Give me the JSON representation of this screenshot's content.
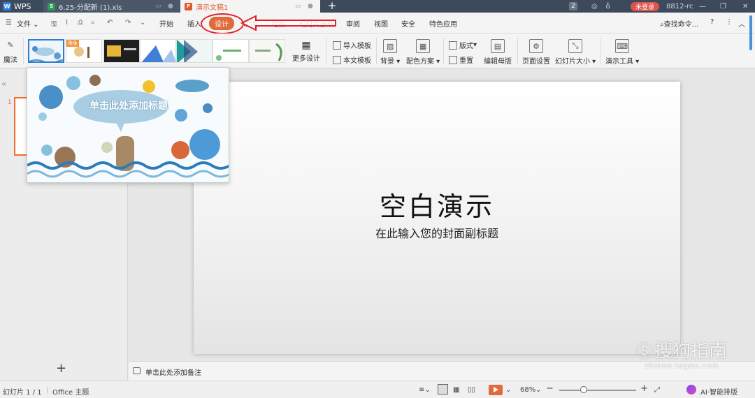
{
  "titlebar": {
    "app_name": "WPS",
    "tabs": [
      {
        "label": "6.25-分配新 (1).xls"
      },
      {
        "label": "演示文稿1"
      }
    ],
    "badge_count": "2",
    "login_label": "未登录",
    "user_id": "8812-rc"
  },
  "menu": {
    "file_label": "文件",
    "items": [
      "开始",
      "插入",
      "设计",
      "切换",
      "动画",
      "幻灯片放映",
      "审阅",
      "视图",
      "安全",
      "特色应用"
    ],
    "active": "设计",
    "search_label": "查找命令..."
  },
  "ribbon": {
    "magic_label": "魔法",
    "template_tag": "限免",
    "more_design_label": "更多设计",
    "import_template_label": "导入模板",
    "body_template_label": "本文模板",
    "background_label": "背景",
    "color_scheme_label": "配色方案",
    "format_label": "版式",
    "reset_label": "重置",
    "edit_master_label": "编辑母版",
    "page_setup_label": "页面设置",
    "slide_size_label": "幻灯片大小",
    "presentation_tools_label": "演示工具"
  },
  "popup": {
    "title_placeholder": "单击此处添加标题"
  },
  "slides_panel": {
    "slide_number": "1",
    "add_label": "+"
  },
  "slide": {
    "title": "空白演示",
    "subtitle": "在此输入您的封面副标题"
  },
  "notes": {
    "placeholder": "单击此处添加备注"
  },
  "status": {
    "slide_counter": "幻灯片 1 / 1",
    "theme_name": "Office 主题",
    "zoom": "68%",
    "ai_label": "AI·智能排版"
  },
  "watermark": {
    "brand": "搜狗指南",
    "url": "zhinan.sogou.com"
  },
  "colors": {
    "accent": "#e06a3a",
    "titlebar": "#3d4a5c",
    "annotation": "#e0202a"
  }
}
